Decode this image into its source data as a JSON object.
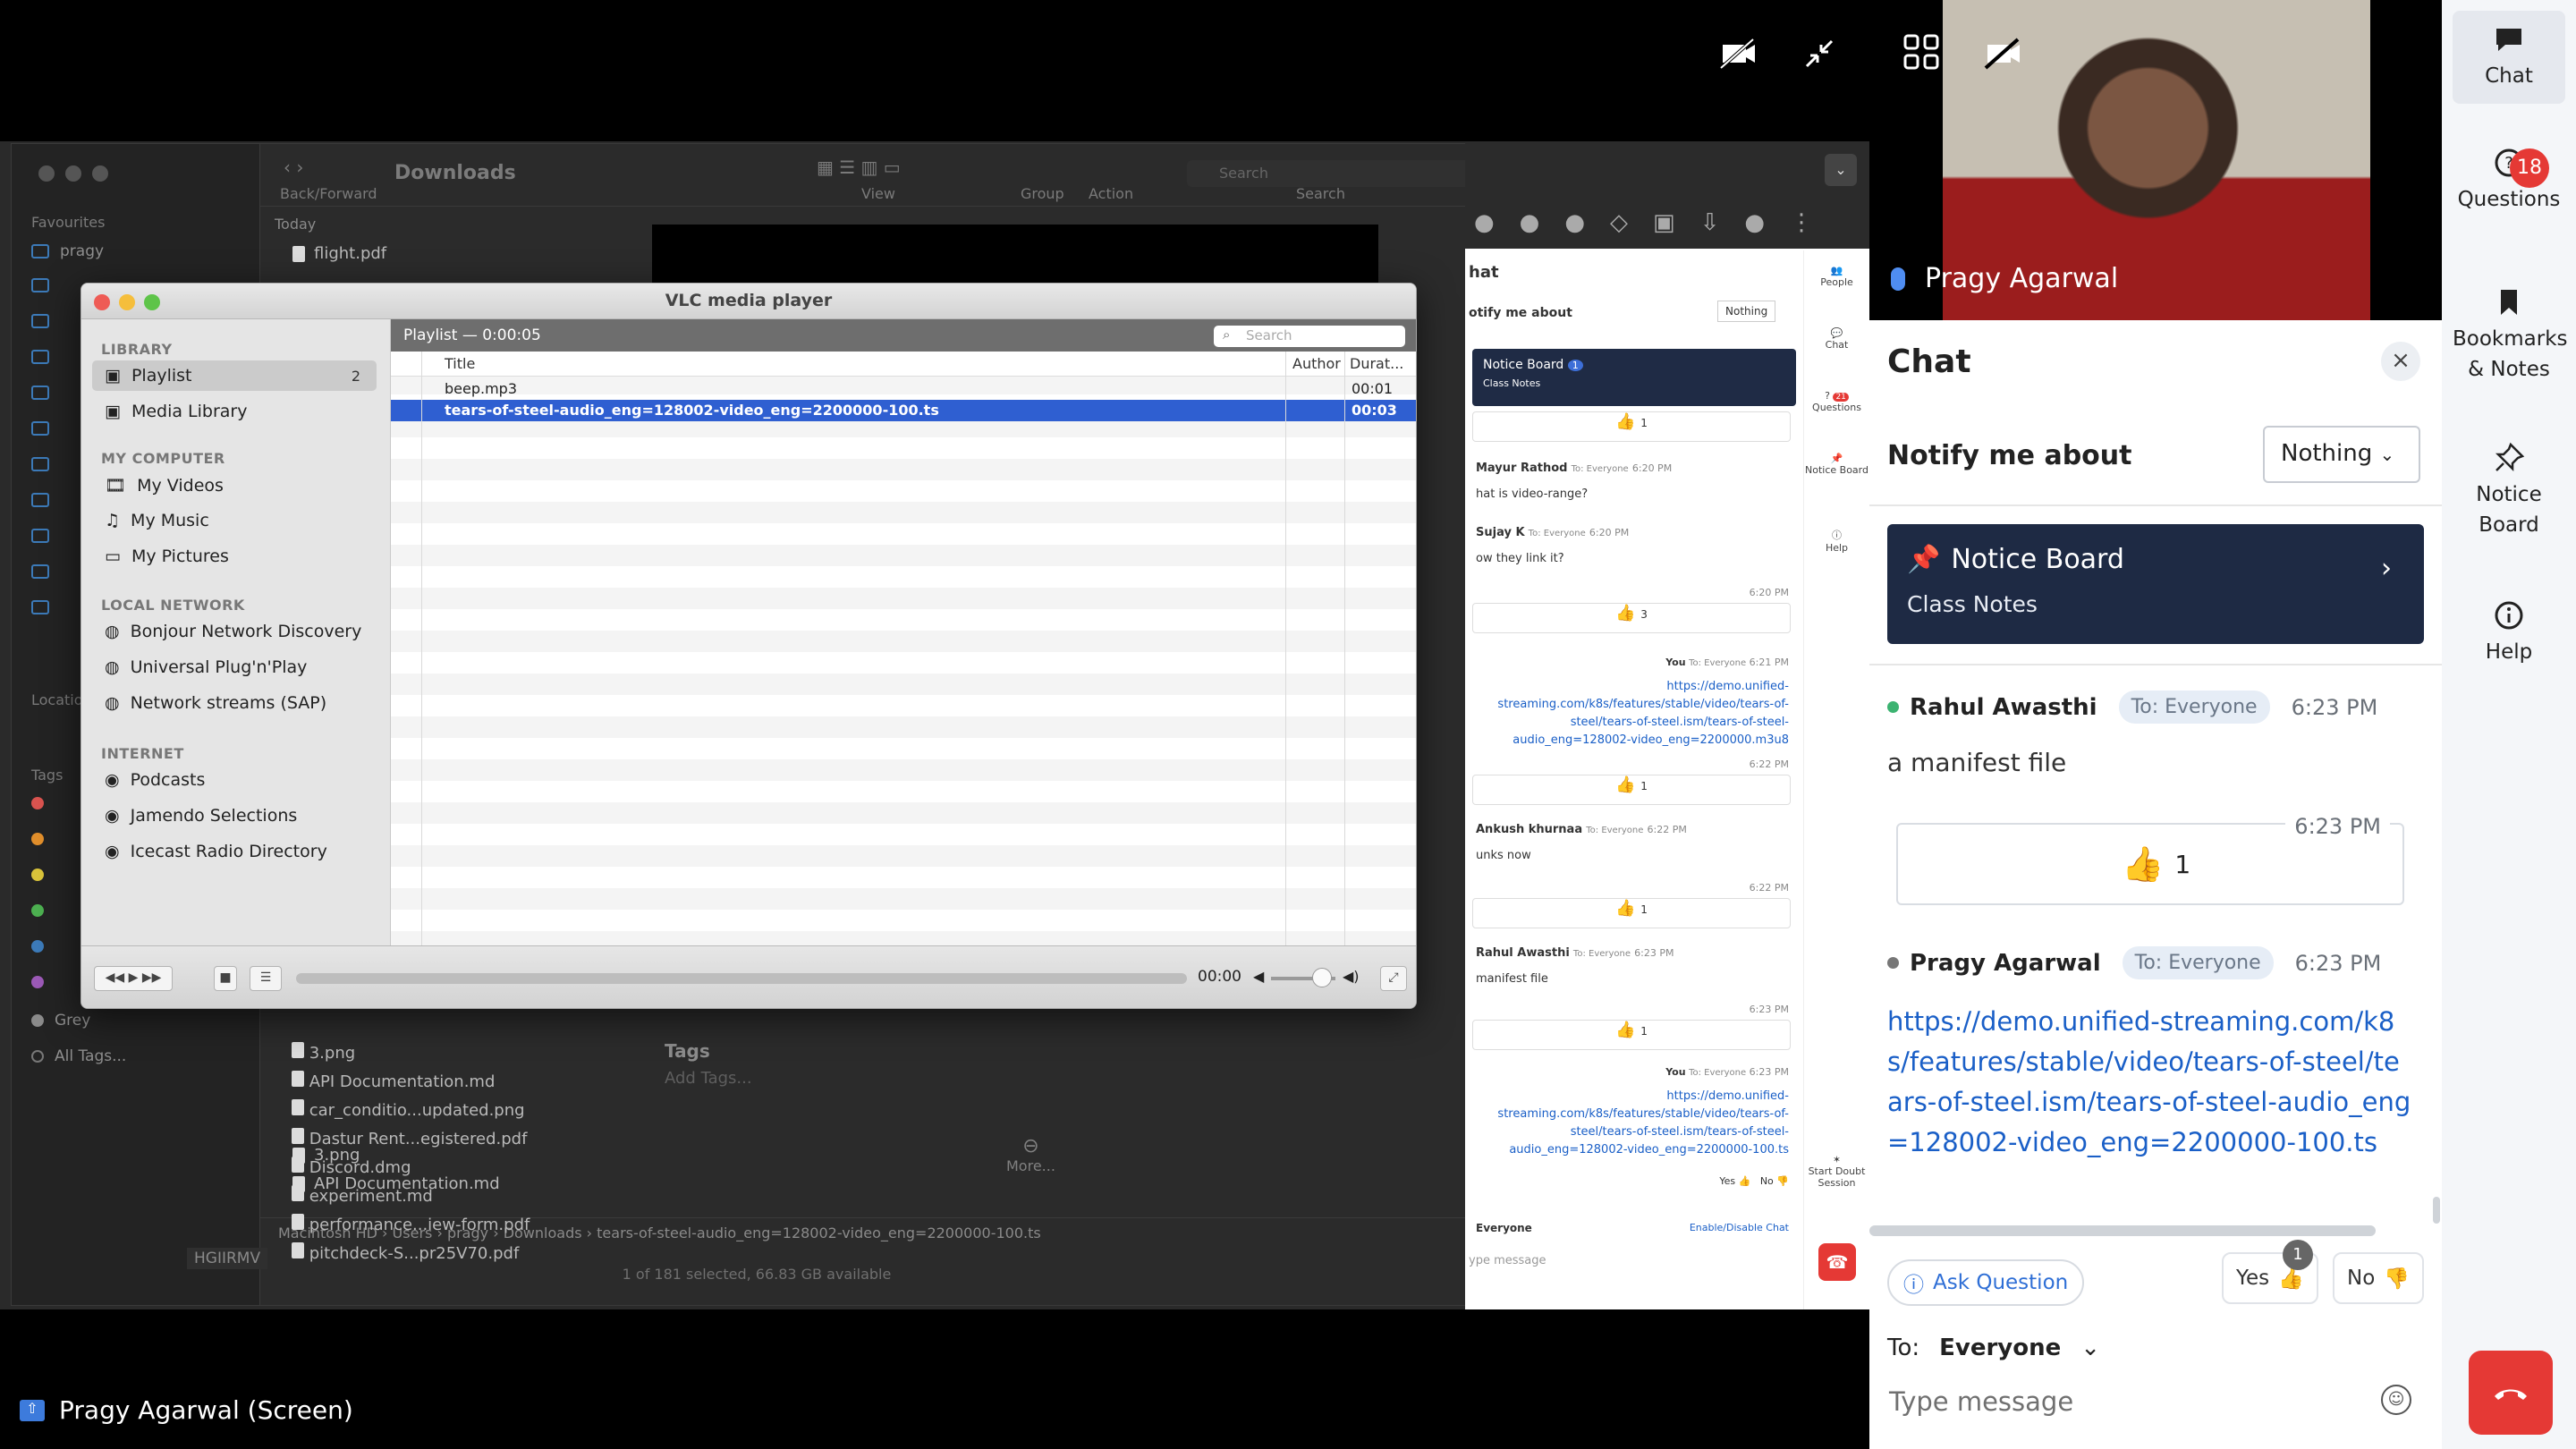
{
  "screen_share": {
    "presenter_label": "Pragy Agarwal (Screen)"
  },
  "finder": {
    "title": "Downloads",
    "toolbar": {
      "back_forward": "Back/Forward",
      "view": "View",
      "group": "Group",
      "action": "Action",
      "search_placeholder": "Search",
      "search_label": "Search"
    },
    "sidebar": {
      "favourites": "Favourites",
      "items": [
        "pragy"
      ],
      "locations": "Locatio",
      "tags": "Tags",
      "tag_items": [
        "Grey",
        "All Tags..."
      ]
    },
    "list_header": "Today",
    "files_top": [
      "flight.pdf"
    ],
    "files_bottom": [
      "3.png",
      "API Documentation.md",
      "car_conditio...updated.png",
      "Dastur Rent...egistered.pdf",
      "Discord.dmg",
      "experiment.md",
      "performance...iew-form.pdf",
      "pitchdeck-S...pr25V70.pdf"
    ],
    "tags_label": "Tags",
    "add_tags": "Add Tags...",
    "more": "More...",
    "hgiirmv": "HGIIRMV",
    "path": [
      "Macintosh HD",
      "Users",
      "pragy",
      "Downloads",
      "tears-of-steel-audio_eng=128002-video_eng=2200000-100.ts"
    ],
    "status": "1 of 181 selected, 66.83 GB available"
  },
  "vlc": {
    "title": "VLC media player",
    "library": "LIBRARY",
    "playlist": "Playlist",
    "playlist_count": "2",
    "media_library": "Media Library",
    "my_computer": "MY COMPUTER",
    "my_videos": "My Videos",
    "my_music": "My Music",
    "my_pictures": "My Pictures",
    "local_network": "LOCAL NETWORK",
    "bonjour": "Bonjour Network Discovery",
    "upnp": "Universal Plug'n'Play",
    "sap": "Network streams (SAP)",
    "internet": "INTERNET",
    "podcasts": "Podcasts",
    "jamendo": "Jamendo Selections",
    "icecast": "Icecast Radio Directory",
    "playlist_header": "Playlist — 0:00:05",
    "search_placeholder": "Search",
    "col_title": "Title",
    "col_author": "Author",
    "col_duration": "Durat...",
    "rows": [
      {
        "title": "beep.mp3",
        "duration": "00:01"
      },
      {
        "title": "tears-of-steel-audio_eng=128002-video_eng=2200000-100.ts",
        "duration": "00:03"
      }
    ],
    "time": "00:00"
  },
  "mini_chat": {
    "title": "hat",
    "notify": "otify me about",
    "notify_value": "Nothing",
    "notice_board": "Notice Board",
    "notice_badge": "1",
    "class_notes": "Class Notes",
    "messages": [
      {
        "name": "Mayur Rathod",
        "to": "To: Everyone",
        "time": "6:20 PM",
        "text": "hat is video-range?"
      },
      {
        "name": "Sujay K",
        "to": "To: Everyone",
        "time": "6:20 PM",
        "text": "ow they link it?"
      },
      {
        "name": "Ankush khurnaa",
        "to": "To: Everyone",
        "time": "6:22 PM",
        "text": "unks now"
      },
      {
        "name": "Rahul Awasthi",
        "to": "To: Everyone",
        "time": "6:23 PM",
        "text": "manifest file"
      }
    ],
    "react_times": [
      "6:20 PM",
      "6:22 PM",
      "6:22 PM",
      "6:23 PM"
    ],
    "react_counts": [
      "1",
      "3",
      "1",
      "1",
      "1"
    ],
    "you_label": "You",
    "you_to": "To: Everyone",
    "you_time_1": "6:21 PM",
    "you_time_2": "6:23 PM",
    "link_1": "https://demo.unified-streaming.com/k8s/features/stable/video/tears-of-steel/tears-of-steel.ism/tears-of-steel-audio_eng=128002-video_eng=2200000.m3u8",
    "link_2": "https://demo.unified-streaming.com/k8s/features/stable/video/tears-of-steel/tears-of-steel.ism/tears-of-steel-audio_eng=128002-video_eng=2200000-100.ts",
    "yes": "Yes",
    "no": "No",
    "to_value": "Everyone",
    "enable_disable": "Enable/Disable Chat",
    "type_placeholder": "ype message",
    "rail": {
      "people": "People",
      "chat": "Chat",
      "questions": "Questions",
      "questions_badge": "21",
      "notice_board": "Notice Board",
      "help": "Help",
      "start_doubt": "Start Doubt Session"
    }
  },
  "video": {
    "participant_name": "Pragy Agarwal"
  },
  "chat": {
    "title": "Chat",
    "notify_label": "Notify me about",
    "notify_value": "Nothing",
    "notice_board_title": "Notice Board",
    "notice_board_subtitle": "Class Notes",
    "messages": [
      {
        "name": "Rahul Awasthi",
        "to": "To: Everyone",
        "time": "6:23 PM",
        "text": "a manifest file",
        "status_color": "#3cb371"
      },
      {
        "name": "Pragy Agarwal",
        "to": "To: Everyone",
        "time": "6:23 PM",
        "status_color": "#777777",
        "link": "https://demo.unified-streaming.com/k8s/features/stable/video/tears-of-steel/tears-of-steel.ism/tears-of-steel-audio_eng=128002-video_eng=2200000-100.ts"
      }
    ],
    "reaction": {
      "time": "6:23 PM",
      "count": "1"
    },
    "ask_question": "Ask Question",
    "yes_label": "Yes",
    "yes_badge": "1",
    "no_label": "No",
    "to_label": "To:",
    "to_value": "Everyone",
    "type_placeholder": "Type message"
  },
  "rail": {
    "chat": "Chat",
    "questions": "Questions",
    "questions_badge": "18",
    "bookmarks": "Bookmarks & Notes",
    "notice_board": "Notice Board",
    "help": "Help"
  },
  "colors": {
    "accent": "#1a5fc7",
    "notice_bg": "#1e2a44",
    "end_call": "#e53935",
    "vlc_selection": "#2f5fd1"
  }
}
